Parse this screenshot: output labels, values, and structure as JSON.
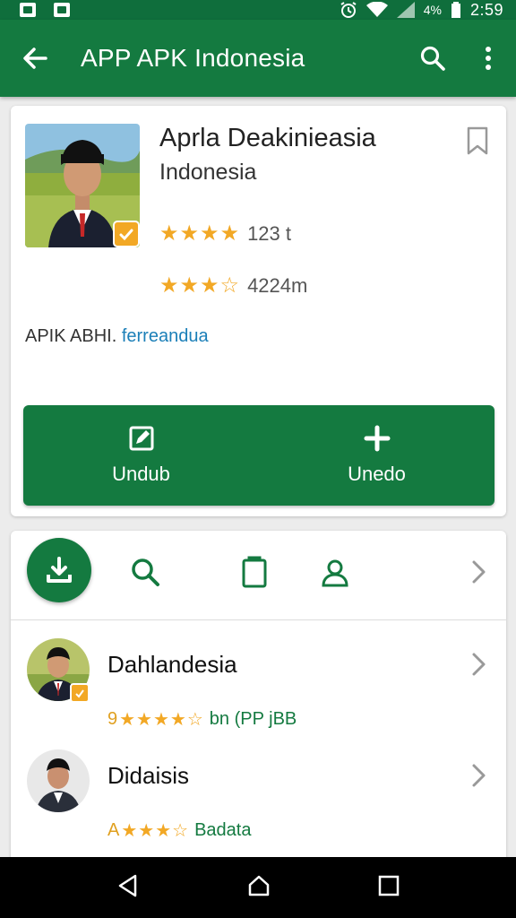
{
  "status_bar": {
    "battery": "4%",
    "time": "2:59"
  },
  "app_bar": {
    "title": "APP APK Indonesia"
  },
  "app_card": {
    "name": "Aprla Deakinieasia",
    "subtitle": "Indonesia",
    "rating_1": {
      "stars": "★★★★",
      "text": "123 t"
    },
    "rating_2": {
      "stars": "★★★",
      "half": "☆",
      "text": "4224m"
    },
    "description_prefix": "APIK ABHI.",
    "description_link": "ferreandua",
    "buttons": [
      {
        "label": "Undub",
        "icon": "edit-icon"
      },
      {
        "label": "Unedo",
        "icon": "plus-icon"
      }
    ]
  },
  "toolbar": {
    "icons": [
      "download-icon",
      "search-icon",
      "clipboard-icon",
      "user-icon",
      "chevron-right-icon"
    ]
  },
  "list": [
    {
      "title": "Dahlandesia",
      "prefix": "9",
      "stars": "★★★★",
      "empty": "☆",
      "meta": "bn (PP jBB"
    },
    {
      "title": "Didaisis",
      "prefix": "A",
      "stars": "★★★",
      "empty": "☆",
      "meta": "Badata"
    }
  ],
  "colors": {
    "primary": "#147a40",
    "status": "#0f6e3c",
    "star": "#f2a825",
    "link": "#1b7fb8"
  }
}
